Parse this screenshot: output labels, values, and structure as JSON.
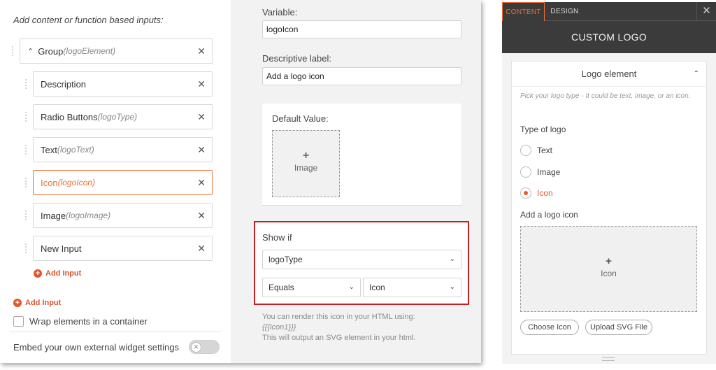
{
  "left": {
    "heading": "Add content or function based inputs:",
    "group": {
      "label": "Group",
      "var": "(logoElement)"
    },
    "items": [
      {
        "label": "Description",
        "var": ""
      },
      {
        "label": "Radio Buttons",
        "var": "(logoType)"
      },
      {
        "label": "Text",
        "var": "(logoText)"
      },
      {
        "label": "Icon",
        "var": "(logoIcon)"
      },
      {
        "label": "Image",
        "var": "(logoImage)"
      },
      {
        "label": "New Input",
        "var": ""
      }
    ],
    "remove_glyph": "✕",
    "add_input_inner": "Add Input",
    "add_input_outer": "Add Input",
    "wrap_label": "Wrap elements in a container",
    "embed_label": "Embed your own external widget settings"
  },
  "config": {
    "variable_label": "Variable:",
    "variable_value": "logoIcon",
    "descriptive_label": "Descriptive label:",
    "descriptive_value": "Add a logo icon",
    "default_value_label": "Default Value:",
    "image_drop_label": "Image",
    "show_if_label": "Show if",
    "show_if_field": "logoType",
    "show_if_operator": "Equals",
    "show_if_value": "Icon",
    "hint_line1": "You can render this icon in your HTML using:",
    "hint_line2": "{{{icon1}}}",
    "hint_line3": "This will output an SVG element in your html."
  },
  "right": {
    "tab_content": "CONTENT",
    "tab_design": "DESIGN",
    "close_glyph": "✕",
    "title": "CUSTOM LOGO",
    "section_title": "Logo element",
    "description": "Pick your logo type - It could be text, image, or an icon.",
    "type_label": "Type of logo",
    "options": [
      "Text",
      "Image",
      "Icon"
    ],
    "selected_option": "Icon",
    "add_icon_label": "Add a logo icon",
    "icon_drop_label": "Icon",
    "choose_icon": "Choose Icon",
    "upload_svg": "Upload SVG File"
  },
  "colors": {
    "accent": "#e8743b",
    "highlight_border": "#c61f23",
    "dark_header": "#3b3b3b"
  }
}
